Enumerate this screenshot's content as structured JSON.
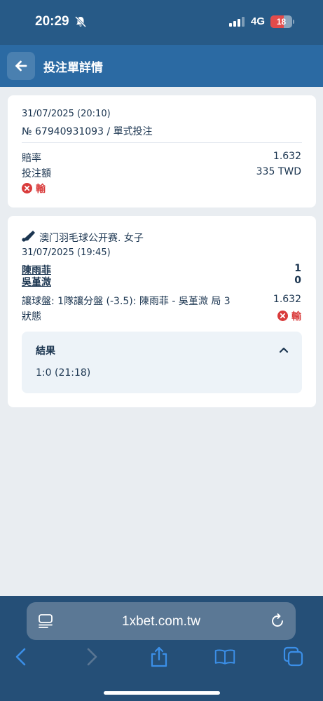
{
  "status_bar": {
    "time": "20:29",
    "network": "4G",
    "battery": "18"
  },
  "header": {
    "title": "投注單詳情"
  },
  "bet_summary": {
    "datetime": "31/07/2025 (20:10)",
    "bet_number": "№ 67940931093 / 單式投注",
    "odds_label": "賠率",
    "odds_value": "1.632",
    "stake_label": "投注額",
    "stake_value": "335 TWD",
    "result_status": "輸"
  },
  "event": {
    "tournament": "澳门羽毛球公开赛. 女子",
    "datetime": "31/07/2025 (19:45)",
    "team1": "陳雨菲",
    "team1_score": "1",
    "team2": "吳堇溦",
    "team2_score": "0",
    "market": "讓球盤: 1隊讓分盤 (-3.5): 陳雨菲 - 吳堇溦 局 3",
    "market_odds": "1.632",
    "status_label": "狀態",
    "status_value": "輸"
  },
  "result": {
    "title": "結果",
    "value": "1:0 (21:18)"
  },
  "browser": {
    "url": "1xbet.com.tw"
  },
  "colors": {
    "header": "#2b6aa3",
    "status_bar": "#275a87",
    "lose": "#d93b3b",
    "safari_bar": "#254f77"
  }
}
